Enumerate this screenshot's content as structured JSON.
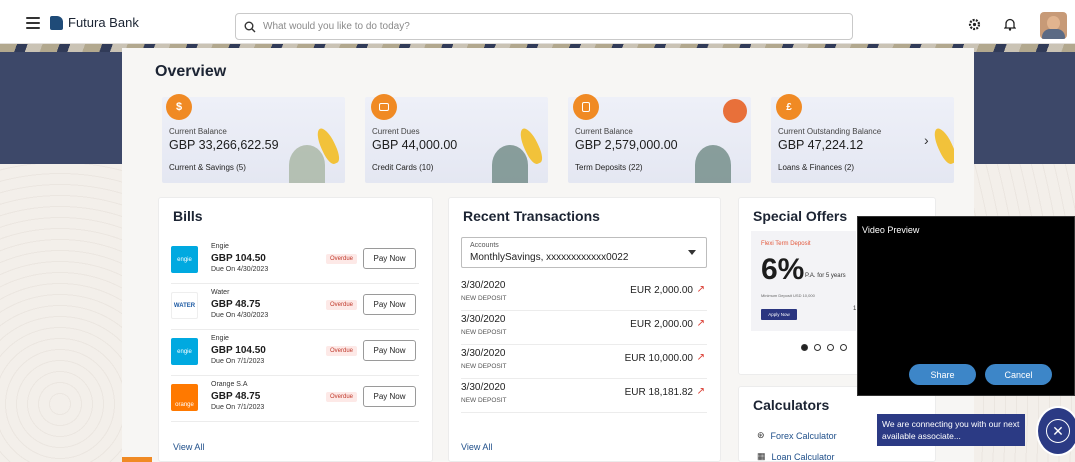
{
  "header": {
    "brand": "Futura Bank",
    "search_placeholder": "What would you like to do today?"
  },
  "overview": {
    "title": "Overview",
    "cards": [
      {
        "label": "Current Balance",
        "amount": "GBP 33,266,622.59",
        "sub": "Current & Savings (5)",
        "icon": "dollar-coin-icon"
      },
      {
        "label": "Current Dues",
        "amount": "GBP 44,000.00",
        "sub": "Credit Cards (10)",
        "icon": "credit-card-icon"
      },
      {
        "label": "Current Balance",
        "amount": "GBP 2,579,000.00",
        "sub": "Term Deposits (22)",
        "icon": "deposit-icon"
      },
      {
        "label": "Current Outstanding Balance",
        "amount": "GBP 47,224.12",
        "sub": "Loans & Finances (2)",
        "icon": "loan-icon"
      }
    ]
  },
  "bills": {
    "title": "Bills",
    "items": [
      {
        "name": "Engie",
        "amount": "GBP 104.50",
        "due": "Due On 4/30/2023",
        "status": "Overdue",
        "action": "Pay Now",
        "logo_text": "engie",
        "logo_color": "#00a9e0"
      },
      {
        "name": "Water",
        "amount": "GBP 48.75",
        "due": "Due On 4/30/2023",
        "status": "Overdue",
        "action": "Pay Now",
        "logo_text": "WATER",
        "logo_color": "#ffffff"
      },
      {
        "name": "Engie",
        "amount": "GBP 104.50",
        "due": "Due On 7/1/2023",
        "status": "Overdue",
        "action": "Pay Now",
        "logo_text": "engie",
        "logo_color": "#00a9e0"
      },
      {
        "name": "Orange S.A",
        "amount": "GBP 48.75",
        "due": "Due On 7/1/2023",
        "status": "Overdue",
        "action": "Pay Now",
        "logo_text": "orange",
        "logo_color": "#ff7900"
      }
    ],
    "view_all": "View All"
  },
  "transactions": {
    "title": "Recent Transactions",
    "account_label": "Accounts",
    "account_value": "MonthlySavings, xxxxxxxxxxxx0022",
    "items": [
      {
        "date": "3/30/2020",
        "type": "NEW DEPOSIT",
        "amount": "EUR 2,000.00"
      },
      {
        "date": "3/30/2020",
        "type": "NEW DEPOSIT",
        "amount": "EUR 2,000.00"
      },
      {
        "date": "3/30/2020",
        "type": "NEW DEPOSIT",
        "amount": "EUR 10,000.00"
      },
      {
        "date": "3/30/2020",
        "type": "NEW DEPOSIT",
        "amount": "EUR 18,181.82"
      }
    ],
    "view_all": "View All"
  },
  "offers": {
    "title": "Special Offers",
    "banner_title": "Flexi Term Deposit",
    "banner_pct": "6%",
    "banner_pa": "P.A. for 5 years",
    "banner_min": "Minimum Deposit USD 10,000",
    "banner_cta": "Apply Now",
    "banner_extra": "1"
  },
  "calculators": {
    "title": "Calculators",
    "items": [
      "Forex Calculator",
      "Loan Calculator"
    ]
  },
  "video": {
    "title": "Video Preview",
    "share": "Share",
    "cancel": "Cancel"
  },
  "chat": {
    "message": "We are connecting you with our next available associate..."
  },
  "colors": {
    "accent": "#f08a24",
    "primary": "#2b3a84",
    "link": "#1f4f8a",
    "overdue": "#c0392b"
  }
}
